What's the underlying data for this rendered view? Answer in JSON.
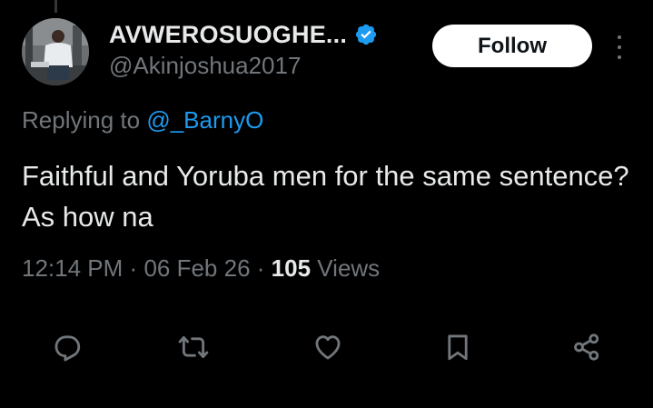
{
  "author": {
    "display_name": "AVWEROSUOGHE...",
    "handle": "@Akinjoshua2017",
    "verified": true,
    "avatar_icon": "user-photo"
  },
  "follow_button": {
    "label": "Follow"
  },
  "more_menu": {
    "icon": "more-vertical-icon"
  },
  "reply_context": {
    "prefix": "Replying to",
    "mention": "@_BarnyO"
  },
  "tweet": {
    "text": "Faithful and Yoruba men for the same sentence? As how na"
  },
  "meta": {
    "time": "12:14 PM",
    "separator": "·",
    "date": "06 Feb 26",
    "views_count": "105",
    "views_label": "Views"
  },
  "actions": [
    {
      "name": "reply",
      "icon": "reply-icon"
    },
    {
      "name": "repost",
      "icon": "repost-icon"
    },
    {
      "name": "like",
      "icon": "heart-icon"
    },
    {
      "name": "bookmark",
      "icon": "bookmark-icon"
    },
    {
      "name": "share",
      "icon": "share-icon"
    }
  ],
  "colors": {
    "background": "#000000",
    "text_primary": "#e7e9ea",
    "text_secondary": "#71767b",
    "accent": "#1d9bf0",
    "follow_bg": "#ffffff"
  }
}
